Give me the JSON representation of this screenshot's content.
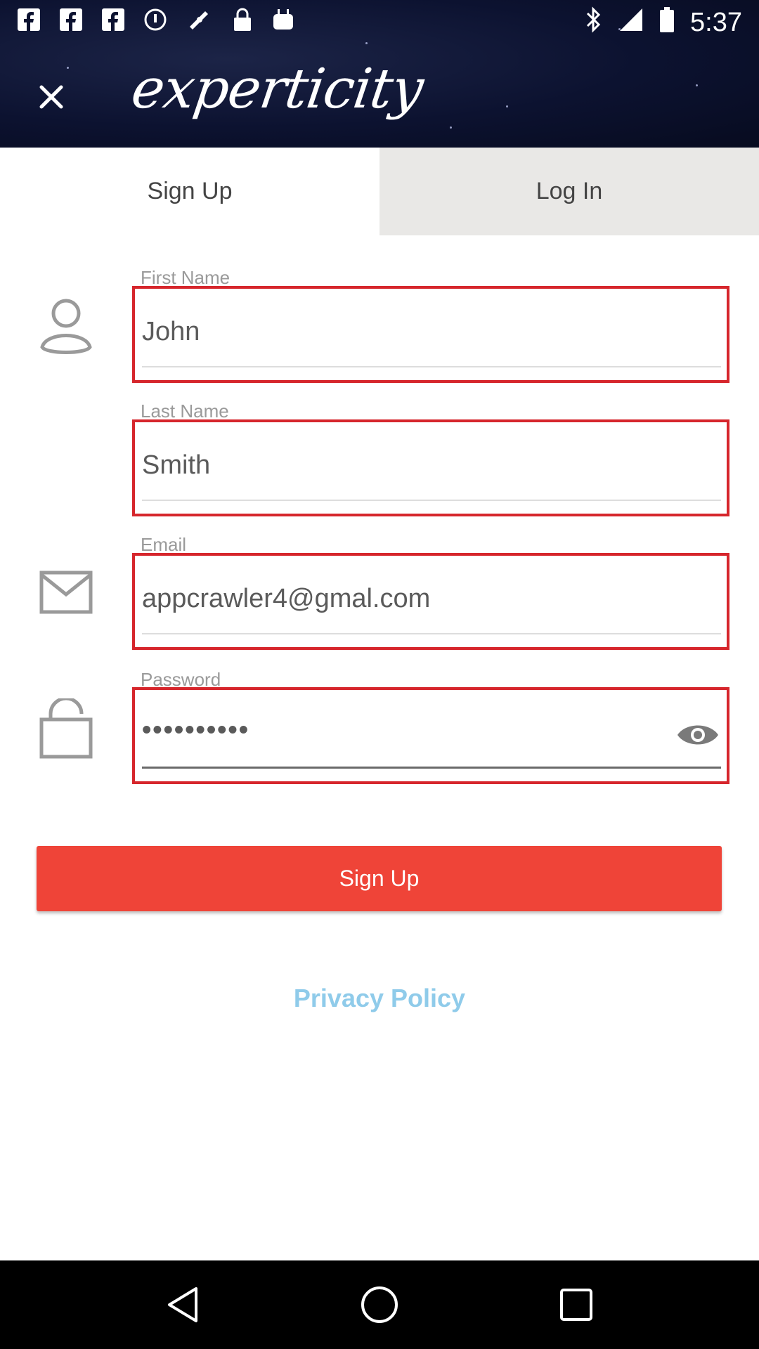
{
  "status_bar": {
    "time": "5:37",
    "icons": [
      "facebook-icon",
      "facebook-icon",
      "facebook-icon",
      "notification-icon",
      "fake-gps-icon",
      "lock-icon",
      "android-icon",
      "bluetooth-icon",
      "signal-icon",
      "battery-icon"
    ]
  },
  "header": {
    "logo_text": "experticity",
    "close_icon": "close-icon"
  },
  "tabs": [
    {
      "label": "Sign Up",
      "active": true
    },
    {
      "label": "Log In",
      "active": false
    }
  ],
  "form": {
    "first_name": {
      "label": "First Name",
      "value": "John"
    },
    "last_name": {
      "label": "Last Name",
      "value": "Smith"
    },
    "email": {
      "label": "Email",
      "value": "appcrawler4@gmal.com"
    },
    "password": {
      "label": "Password",
      "value": "••••••••••"
    }
  },
  "actions": {
    "signup_label": "Sign Up",
    "privacy_label": "Privacy Policy"
  },
  "colors": {
    "accent": "#ef4438",
    "field_border": "#d6262c",
    "link": "#8fcbea",
    "header_bg": "#0c1230"
  }
}
